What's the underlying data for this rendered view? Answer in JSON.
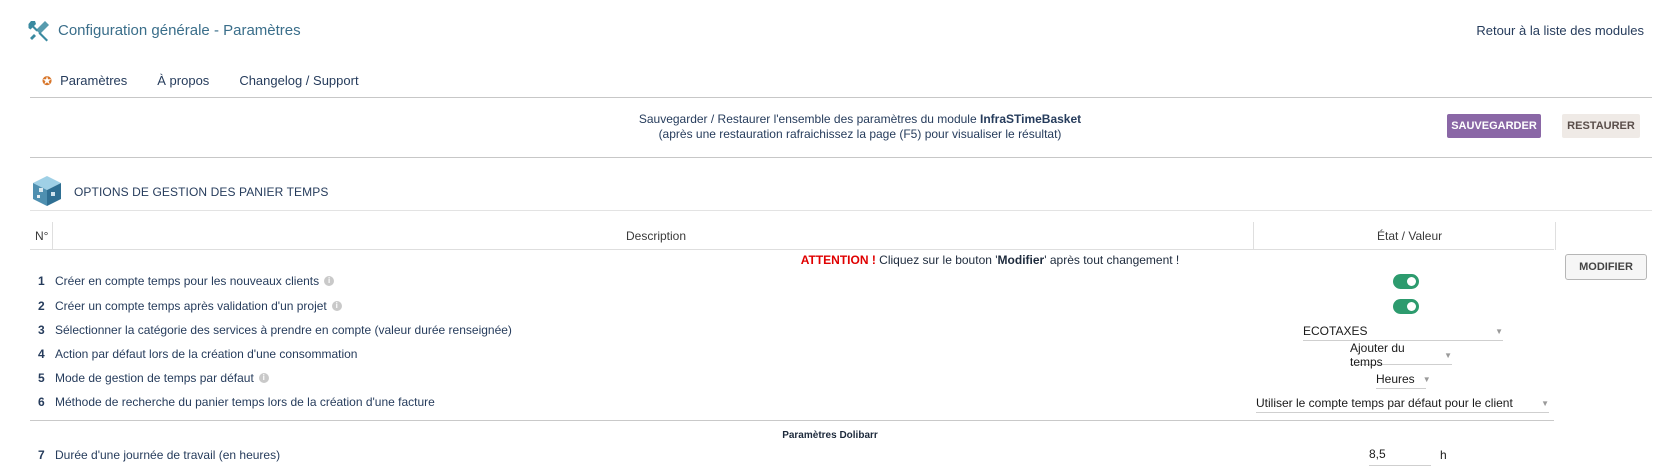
{
  "header": {
    "title": "Configuration générale - Paramètres",
    "back_link": "Retour à la liste des modules"
  },
  "tabs": [
    {
      "label": "Paramètres"
    },
    {
      "label": "À propos"
    },
    {
      "label": "Changelog / Support"
    }
  ],
  "backup": {
    "line1_prefix": "Sauvegarder / Restaurer l'ensemble des paramètres du module ",
    "module_name": "InfraSTimeBasket",
    "line2": "(après une restauration rafraichissez la page (F5) pour visualiser le résultat)",
    "save_label": "SAUVEGARDER",
    "restore_label": "RESTAURER"
  },
  "section": {
    "title": "OPTIONS DE GESTION DES PANIER TEMPS"
  },
  "table": {
    "col_num": "N°",
    "col_desc": "Description",
    "col_value": "État / Valeur",
    "attention_label": "ATTENTION !",
    "attention_pre": " Cliquez sur le bouton '",
    "attention_strong": "Modifier",
    "attention_post": "' après tout changement !",
    "modify_label": "MODIFIER",
    "rows": [
      {
        "num": "1",
        "label": "Créer en compte temps pour les nouveaux clients",
        "value": true
      },
      {
        "num": "2",
        "label": "Créer un compte temps après validation d'un projet",
        "value": true
      },
      {
        "num": "3",
        "label": "Sélectionner la catégorie des services à prendre en compte (valeur durée renseignée)",
        "value": "ECOTAXES"
      },
      {
        "num": "4",
        "label": "Action par défaut lors de la création d'une consommation",
        "value": "Ajouter du temps"
      },
      {
        "num": "5",
        "label": "Mode de gestion de temps par défaut",
        "value": "Heures"
      },
      {
        "num": "6",
        "label": "Méthode de recherche du panier temps lors de la création d'une facture",
        "value": "Utiliser le compte temps par défaut pour le client"
      },
      {
        "num": "7",
        "label": "Durée d'une journée de travail (en heures)",
        "value": "8,5",
        "unit": "h"
      }
    ],
    "subheader": "Paramètres Dolibarr"
  },
  "colors": {
    "accent": "#8a67a6",
    "toggle_on": "#2d9b6e",
    "attention": "#e00000"
  }
}
